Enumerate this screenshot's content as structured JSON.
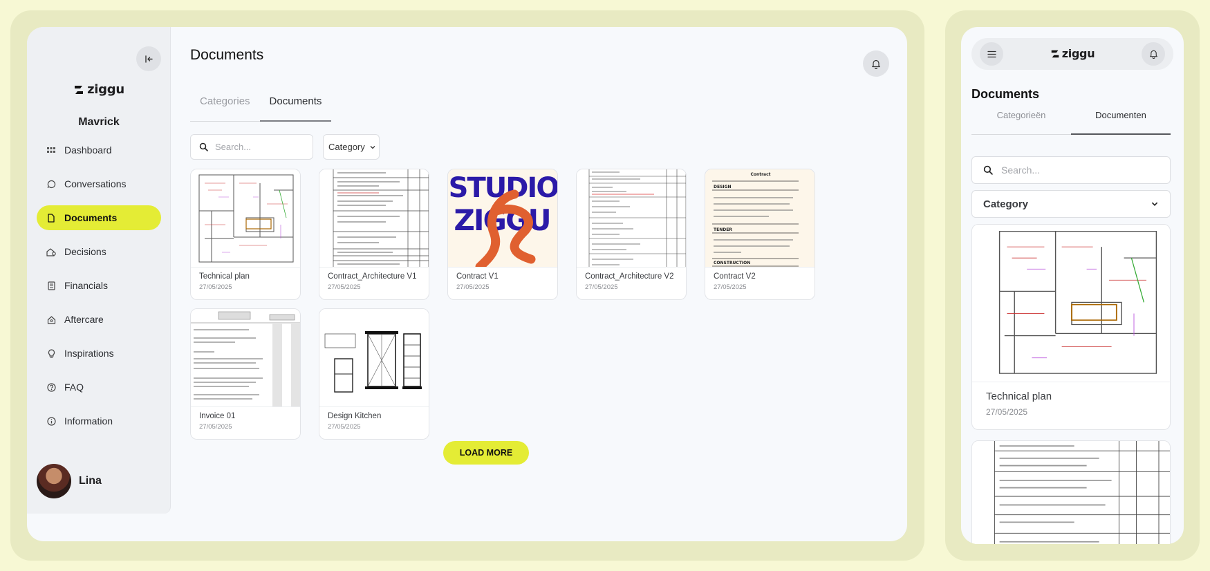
{
  "brand": {
    "name": "ziggu",
    "accent": "#e4ec35"
  },
  "sidebar": {
    "project": "Mavrick",
    "items": [
      {
        "label": "Dashboard",
        "icon": "grid-icon"
      },
      {
        "label": "Conversations",
        "icon": "chat-icon"
      },
      {
        "label": "Documents",
        "icon": "document-icon",
        "active": true
      },
      {
        "label": "Decisions",
        "icon": "decision-icon"
      },
      {
        "label": "Financials",
        "icon": "receipt-icon"
      },
      {
        "label": "Aftercare",
        "icon": "home-icon"
      },
      {
        "label": "Inspirations",
        "icon": "bulb-icon"
      },
      {
        "label": "FAQ",
        "icon": "question-icon"
      },
      {
        "label": "Information",
        "icon": "info-icon"
      }
    ],
    "user": {
      "name": "Lina"
    }
  },
  "main": {
    "title": "Documents",
    "tabs": [
      {
        "label": "Categories"
      },
      {
        "label": "Documents",
        "active": true
      }
    ],
    "search": {
      "placeholder": "Search..."
    },
    "category_select": {
      "value": "Category"
    },
    "documents": [
      {
        "title": "Technical plan",
        "date": "27/05/2025",
        "thumb": "floorplan"
      },
      {
        "title": "Contract_Architecture V1",
        "date": "27/05/2025",
        "thumb": "table"
      },
      {
        "title": "Contract V1",
        "date": "27/05/2025",
        "thumb": "studio"
      },
      {
        "title": "Contract_Architecture V2",
        "date": "27/05/2025",
        "thumb": "table"
      },
      {
        "title": "Contract V2",
        "date": "27/05/2025",
        "thumb": "contract"
      },
      {
        "title": "Invoice 01",
        "date": "27/05/2025",
        "thumb": "invoice"
      },
      {
        "title": "Design Kitchen",
        "date": "27/05/2025",
        "thumb": "kitchen"
      }
    ],
    "load_more": "LOAD MORE",
    "thumb_text": {
      "studio_line1": "STUDIO",
      "studio_line2": "ZIGGU",
      "contract_heading": "Contract",
      "contract_sections": [
        "DESIGN",
        "TENDER",
        "CONSTRUCTION"
      ]
    }
  },
  "mobile": {
    "title": "Documents",
    "tabs": [
      {
        "label": "Categorieën"
      },
      {
        "label": "Documenten",
        "active": true
      }
    ],
    "search": {
      "placeholder": "Search..."
    },
    "category_select": {
      "value": "Category"
    },
    "cards": [
      {
        "title": "Technical plan",
        "date": "27/05/2025"
      }
    ]
  }
}
